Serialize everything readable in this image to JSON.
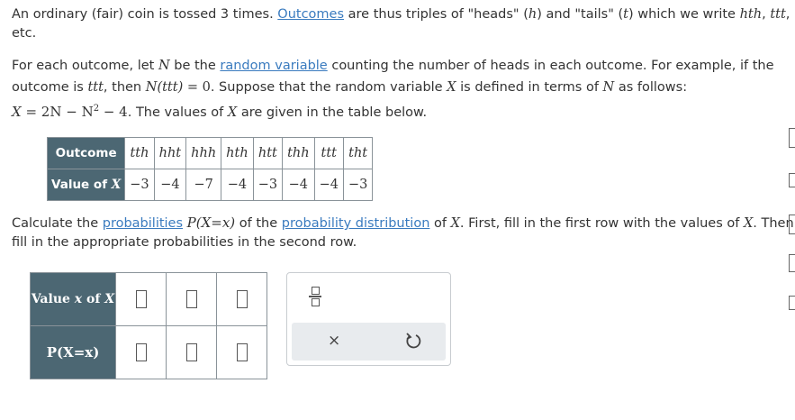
{
  "para1": {
    "t1": "An ordinary (fair) coin is tossed 3 times. ",
    "link_outcomes": "Outcomes",
    "t2": " are thus triples of \"heads\" (",
    "h": "h",
    "t3": ") and \"tails\" (",
    "t": "t",
    "t4": ") which we write ",
    "hth": "hth",
    "comma": ", ",
    "ttt": "ttt",
    "t5": ",",
    "line2": "etc."
  },
  "para2": {
    "a1": "For each outcome, let ",
    "N": "N",
    "a2": " be the ",
    "link_rv": "random variable",
    "a3": " counting the number of heads in each outcome. For example, if the",
    "b1": "outcome is ",
    "ttt": "ttt",
    "b2": ", then ",
    "Nttt": "N(ttt)",
    "b3": " = 0",
    "b4": ". Suppose that the random variable ",
    "X": "X",
    "b5": " is defined in terms of ",
    "N2": "N",
    "b6": " as follows:",
    "formula_lhs": "X",
    "formula_rhs": " = 2N − N",
    "formula_sup": "2",
    "formula_tail": " − 4",
    "c1": ". The values of ",
    "X2": "X",
    "c2": " are given in the table below."
  },
  "table1": {
    "row1_header": "Outcome",
    "row2_header": "Value of ",
    "row2_header_var": "X",
    "outcomes": [
      "tth",
      "hht",
      "hhh",
      "hth",
      "htt",
      "thh",
      "ttt",
      "tht"
    ],
    "values": [
      "−3",
      "−4",
      "−7",
      "−4",
      "−3",
      "−4",
      "−4",
      "−3"
    ]
  },
  "para3": {
    "a1": "Calculate the ",
    "link_prob": "probabilities",
    "a2": " ",
    "P": "P(X=x)",
    "a3": " of the ",
    "link_dist": "probability distribution",
    "a4": " of ",
    "X": "X",
    "a5": ". First, fill in the first row with the values of ",
    "X2": "X",
    "a6": ". Then",
    "line2": "fill in the appropriate probabilities in the second row."
  },
  "table2": {
    "row1_header": "Value ",
    "row1_var": "x",
    "row1_mid": " of ",
    "row1_var2": "X",
    "row2_header": "P(X=x)",
    "cells": 3
  },
  "toolbar": {
    "fraction_icon": "fraction-icon",
    "clear_label": "×",
    "undo_icon": "undo-icon"
  }
}
